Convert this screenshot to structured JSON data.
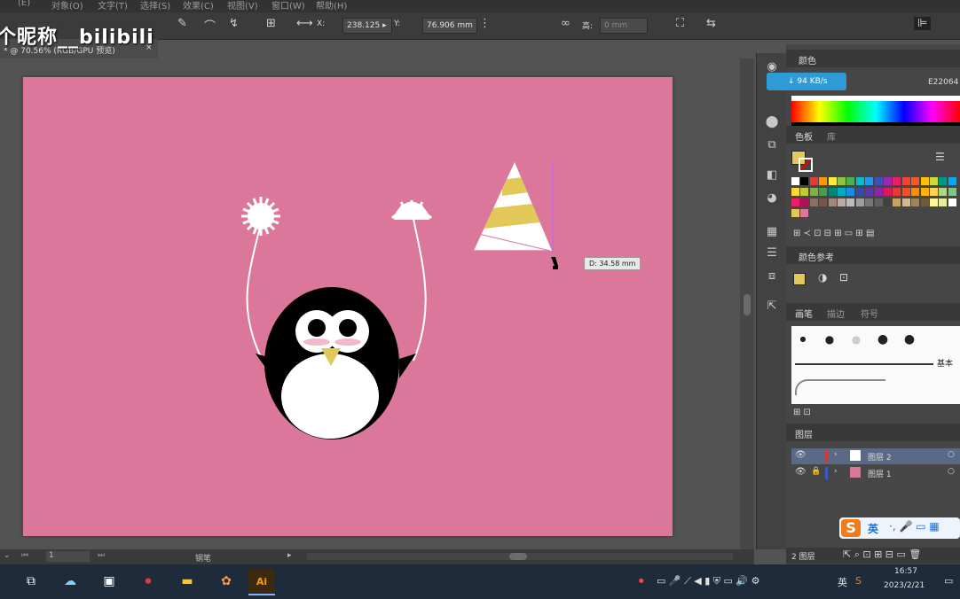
{
  "watermark": {
    "text": "个昵称__bilibili"
  },
  "menu": [
    "(E)",
    "对象(O)",
    "文字(T)",
    "选择(S)",
    "效果(C)",
    "视图(V)",
    "窗口(W)",
    "帮助(H)"
  ],
  "controlbar": {
    "x_label": "X:",
    "x_value": "238.125 ▸",
    "y_label": "Y:",
    "y_value": "76.906 mm",
    "w_label": "宽:",
    "h_label": "高:",
    "h_value": "0 mm"
  },
  "document_tab": {
    "title": "* @ 70.56% (RGB/GPU 预览)",
    "close": "×"
  },
  "canvas": {
    "measure_tooltip": "D: 34.58 mm",
    "artboard_color": "#db779a"
  },
  "statusbar": {
    "page": "1",
    "tool": "钢笔"
  },
  "panels": {
    "color": {
      "title": "颜色",
      "hex_value": "E22064",
      "speed_badge": "↓ 94 KB/s"
    },
    "swatches": {
      "tabs": [
        "色板",
        "库"
      ]
    },
    "color_guide": {
      "title": "颜色参考"
    },
    "brushes": {
      "tabs": [
        "画笔",
        "描边",
        "符号"
      ],
      "basic_label": "基本"
    },
    "layers": {
      "title": "图层",
      "items": [
        {
          "name": "图层 2",
          "color": "#c83c3c"
        },
        {
          "name": "图层 1",
          "color": "#3c5bc8"
        }
      ],
      "footer": "2 图层"
    }
  },
  "ime": {
    "lang": "英"
  },
  "taskbar": {
    "time": "16:57",
    "date": "2023/2/21",
    "ime_label": "英"
  },
  "colors": {
    "pink": "#db779a",
    "flag_yellow": "#e2c858",
    "accent_blue": "#2e9bd6"
  }
}
